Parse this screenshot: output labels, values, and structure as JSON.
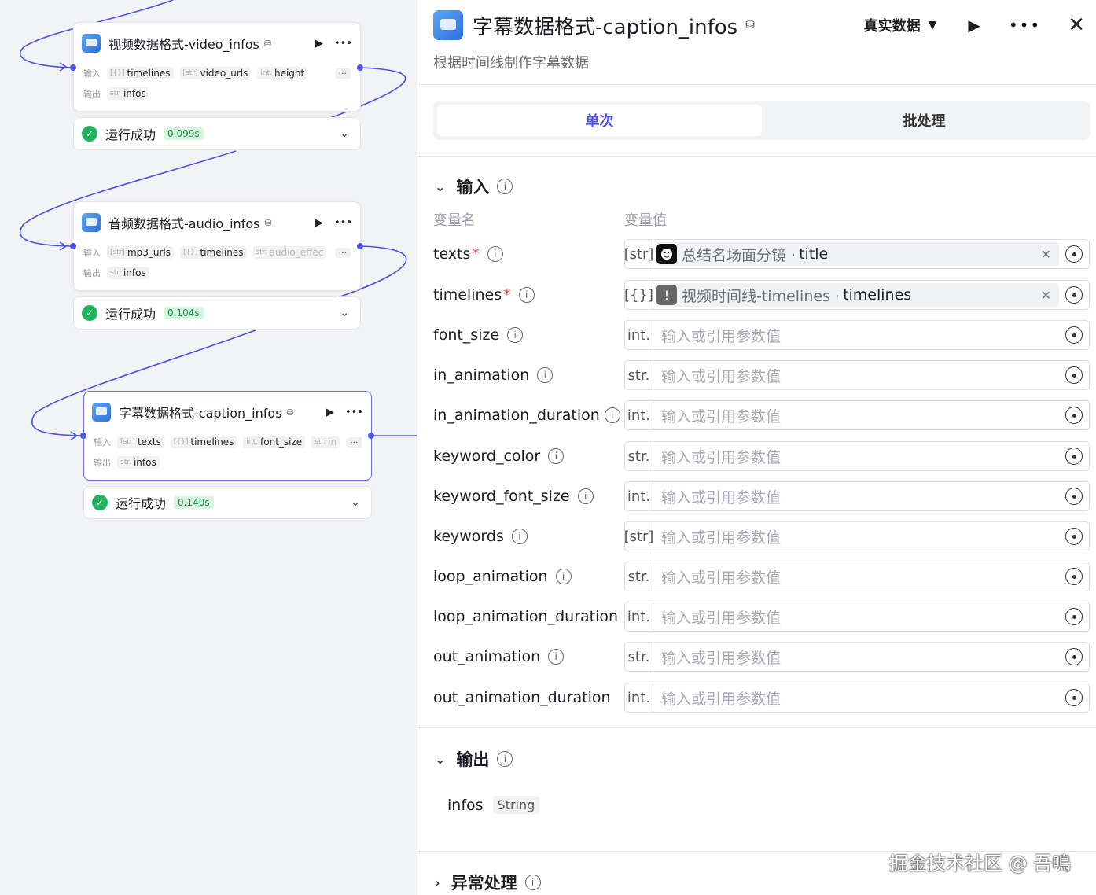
{
  "canvas": {
    "nodes": [
      {
        "title": "视频数据格式-video_infos",
        "input_label": "输入",
        "output_label": "输出",
        "inputs": [
          {
            "type": "[{}]",
            "name": "timelines"
          },
          {
            "type": "[str]",
            "name": "video_urls"
          },
          {
            "type": "int.",
            "name": "height"
          }
        ],
        "outputs": [
          {
            "type": "str.",
            "name": "infos"
          }
        ],
        "more": "···",
        "status": {
          "text": "运行成功",
          "time": "0.099s"
        }
      },
      {
        "title": "音频数据格式-audio_infos",
        "input_label": "输入",
        "output_label": "输出",
        "inputs": [
          {
            "type": "[str]",
            "name": "mp3_urls"
          },
          {
            "type": "[{}]",
            "name": "timelines"
          },
          {
            "type": "str.",
            "name": "audio_effec"
          }
        ],
        "outputs": [
          {
            "type": "str.",
            "name": "infos"
          }
        ],
        "more": "···",
        "status": {
          "text": "运行成功",
          "time": "0.104s"
        }
      },
      {
        "title": "字幕数据格式-caption_infos",
        "input_label": "输入",
        "output_label": "输出",
        "inputs": [
          {
            "type": "[str]",
            "name": "texts"
          },
          {
            "type": "[{}]",
            "name": "timelines"
          },
          {
            "type": "int.",
            "name": "font_size"
          },
          {
            "type": "str.",
            "name": "in"
          }
        ],
        "outputs": [
          {
            "type": "str.",
            "name": "infos"
          }
        ],
        "more": "···",
        "status": {
          "text": "运行成功",
          "time": "0.140s"
        }
      }
    ]
  },
  "panel": {
    "title": "字幕数据格式-caption_infos",
    "description": "根据时间线制作字幕数据",
    "mode_select": "真实数据",
    "tabs": [
      {
        "label": "单次",
        "active": true
      },
      {
        "label": "批处理",
        "active": false
      }
    ],
    "input_section": {
      "title": "输入",
      "col_name": "变量名",
      "col_value": "变量值",
      "placeholder": "输入或引用参数值",
      "rows": [
        {
          "name": "texts",
          "required": "*",
          "type": "[str]",
          "ref": {
            "icon": "bot-icon",
            "source": "总结名场面分镜 ·",
            "var": "title"
          }
        },
        {
          "name": "timelines",
          "required": "*",
          "type": "[{}]",
          "ref": {
            "icon": "alert-icon",
            "source": "视频时间线-timelines ·",
            "var": "timelines"
          }
        },
        {
          "name": "font_size",
          "type": "int."
        },
        {
          "name": "in_animation",
          "type": "str."
        },
        {
          "name": "in_animation_duration",
          "type": "int."
        },
        {
          "name": "keyword_color",
          "type": "str."
        },
        {
          "name": "keyword_font_size",
          "type": "int."
        },
        {
          "name": "keywords",
          "type": "[str]"
        },
        {
          "name": "loop_animation",
          "type": "str."
        },
        {
          "name": "loop_animation_duration",
          "type": "int."
        },
        {
          "name": "out_animation",
          "type": "str."
        },
        {
          "name": "out_animation_duration",
          "type": "int."
        }
      ]
    },
    "output_section": {
      "title": "输出",
      "name": "infos",
      "type": "String"
    },
    "error_section": {
      "title": "异常处理"
    }
  },
  "watermark": "掘金技术社区 @ 吾鳴",
  "colors": {
    "accent": "#4e52e8",
    "success": "#22b35e",
    "required": "#e54545"
  }
}
